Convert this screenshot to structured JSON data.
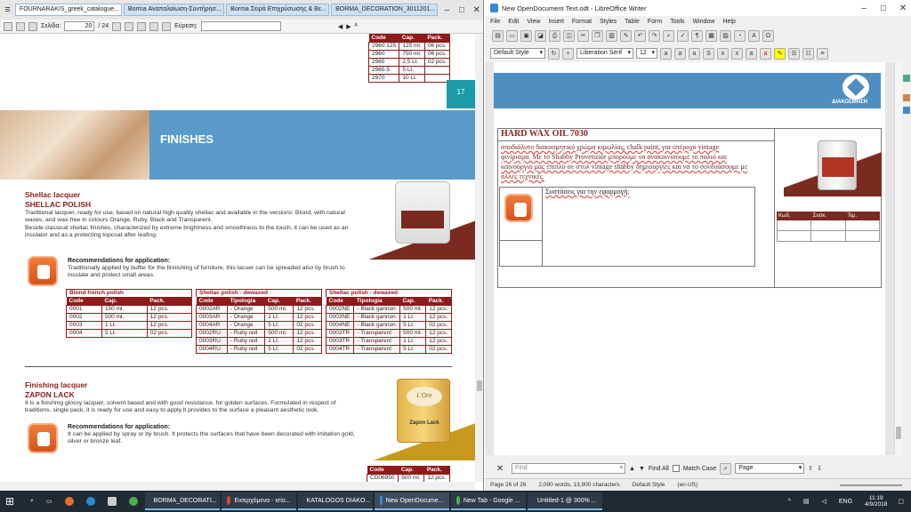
{
  "pdf": {
    "tabs": [
      "FOURNARAKIS_greek_catalogue...",
      "Borma  Αναπαλαίωση-Συντήρησ...",
      "Borma  Σειρά Επιχρύσωσης & Βε...",
      "BORMA_DECORATION_3011201..."
    ],
    "toolbar": {
      "page_label": "Σελίδα:",
      "page_value": "20",
      "page_total": "/ 24",
      "search_label": "Εύρεση:"
    },
    "top_table": [
      [
        "2960.125",
        "125 ml.",
        "06 pcs."
      ],
      [
        "2960",
        "750 ml.",
        "06 pcs."
      ],
      [
        "2965",
        "2,5 Lt.",
        "02 pcs."
      ],
      [
        "2965.5",
        "5 Lt.",
        ""
      ],
      [
        "2970",
        "10 Lt.",
        ""
      ]
    ],
    "page_number": "17",
    "banner": "FINISHES",
    "shellac": {
      "title_it": "Shellac lacquer",
      "title_en": "SHELLAC POLISH",
      "desc1": "Traditional lacquer, ready for use, based on natural high quality shellac and available in the versions: Blond, with natural waxes, and wax-free in colours Orange, Ruby, Black and Transparent.",
      "desc2": "Beside classical shellac finishes, characterized by extreme brightness and smoothness to the touch, it can be used as an insulator and as a protecting topcoat after leafing.",
      "rec_title": "Recommendations for application:",
      "rec_text": "Traditionally applied by buffer for the finnishing of furniture, this lacuer can be spreaded also by brush to insulate and protect small areas."
    },
    "t1": {
      "caption": "Blond french polish",
      "headers": [
        "Code",
        "Cap.",
        "Pack."
      ],
      "rows": [
        [
          "0001",
          "150 ml.",
          "12 pcs."
        ],
        [
          "0002",
          "500 ml.",
          "12 pcs."
        ],
        [
          "0003",
          "1 Lt.",
          "12 pcs."
        ],
        [
          "0004",
          "5 Lt.",
          "02 pcs."
        ]
      ]
    },
    "t2": {
      "caption": "Shellac polish - dewaxed",
      "headers": [
        "Code",
        "Tipologia",
        "Cap.",
        "Pack."
      ],
      "rows": [
        [
          "0002AR",
          "- Orange",
          "500 ml.",
          "12 pcs."
        ],
        [
          "0003AR",
          "- Orange",
          "1 Lt.",
          "12 pcs."
        ],
        [
          "0004AR",
          "- Orange",
          "5 Lt.",
          "02 pcs."
        ],
        [
          "0002RU",
          "- Ruby red",
          "500 ml.",
          "12 pcs."
        ],
        [
          "0003RU",
          "- Ruby red",
          "1 Lt.",
          "12 pcs."
        ],
        [
          "0004RU",
          "- Ruby red",
          "5 Lt.",
          "02 pcs."
        ]
      ]
    },
    "t3": {
      "caption": "Shellac polish - dewaxed",
      "headers": [
        "Code",
        "Tipologia",
        "Cap.",
        "Pack."
      ],
      "rows": [
        [
          "0002NE",
          "- Black gannon",
          "500 ml.",
          "12 pcs."
        ],
        [
          "0003NE",
          "- Black gannon",
          "1 Lt.",
          "12 pcs."
        ],
        [
          "0004NE",
          "- Black gannon",
          "5 Lt.",
          "02 pcs."
        ],
        [
          "0002TR",
          "- Transparent",
          "500 ml.",
          "12 pcs."
        ],
        [
          "0003TR",
          "- Transparent",
          "1 Lt.",
          "12 pcs."
        ],
        [
          "0004TR",
          "- Transparent",
          "5 Lt.",
          "02 pcs."
        ]
      ]
    },
    "zapon": {
      "title_it": "Finishing lacquer",
      "title_en": "ZAPON LACK",
      "desc": "It is  a finishing glossy lacquer, solvent based and with good resistance, for golden surfaces. Formulated in respect of traditions, single pack, it is ready for use and easy to apply.It provides to the surface a pleasant aesthetic look.",
      "rec_title": "Recommendations for application:",
      "rec_text": "It can be applied by spray or by brush. It protects the surfaces that have been decorated with imitation gold, silver or bronze leaf.",
      "can_label": "Zapon Lack",
      "can_brand": "L'Oro"
    },
    "t4": {
      "headers": [
        "Code",
        "Cap.",
        "Pack."
      ],
      "rows": [
        [
          "CD06950",
          "500 ml.",
          "12 pcs."
        ]
      ]
    }
  },
  "writer": {
    "title": "New OpenDocument Text.odt - LibreOffice Writer",
    "menu": [
      "File",
      "Edit",
      "View",
      "Insert",
      "Format",
      "Styles",
      "Table",
      "Form",
      "Tools",
      "Window",
      "Help"
    ],
    "para_style": "Default Style",
    "font_name": "Liberation Serif",
    "font_size": "12",
    "logo_text": "ΔΙΑΚΟΣΜΗΣΗ",
    "heading": "HARD WAX OIL 7030",
    "body_line1": "αποδιάλυτο διακοσμητικό χρώμα κιμωλίας, chalk paint, για υπέροχο vintage",
    "body_line2": "φινίρισμα. Με το Shabby Provenzale μπορούμε να ανακαινίσουμε το παλιό και",
    "body_line3": "καινούργιο μας έπιπλο σε στυλ vintage shabby δημιουργίες και να το συνδυάσουμε με",
    "body_line4": "άλλες τεχνικές.",
    "rec_label": "Συστάσεις για την εφαρμογή:",
    "table_headers": [
      "Κωδ.",
      "Συσκ.",
      "Τεμ."
    ],
    "find_placeholder": "Find",
    "find_all": "Find All",
    "match_case": "Match Case",
    "page_option": "Page",
    "status": {
      "page": "Page 26 of 26",
      "words": "2,090 words, 13,900 characters",
      "style": "Default Style",
      "lang": "(en-US)"
    }
  },
  "taskbar": {
    "items": [
      "BORMA_DECORATI...",
      "Εισερχόμενα - xrio...",
      "KATALOGOS DIAKO...",
      "New OpenDocume...",
      "New Tab - Google ...",
      "Untitled-1 @ 300% ..."
    ],
    "lang": "ENG",
    "time": "11:19",
    "date": "4/9/2018"
  }
}
